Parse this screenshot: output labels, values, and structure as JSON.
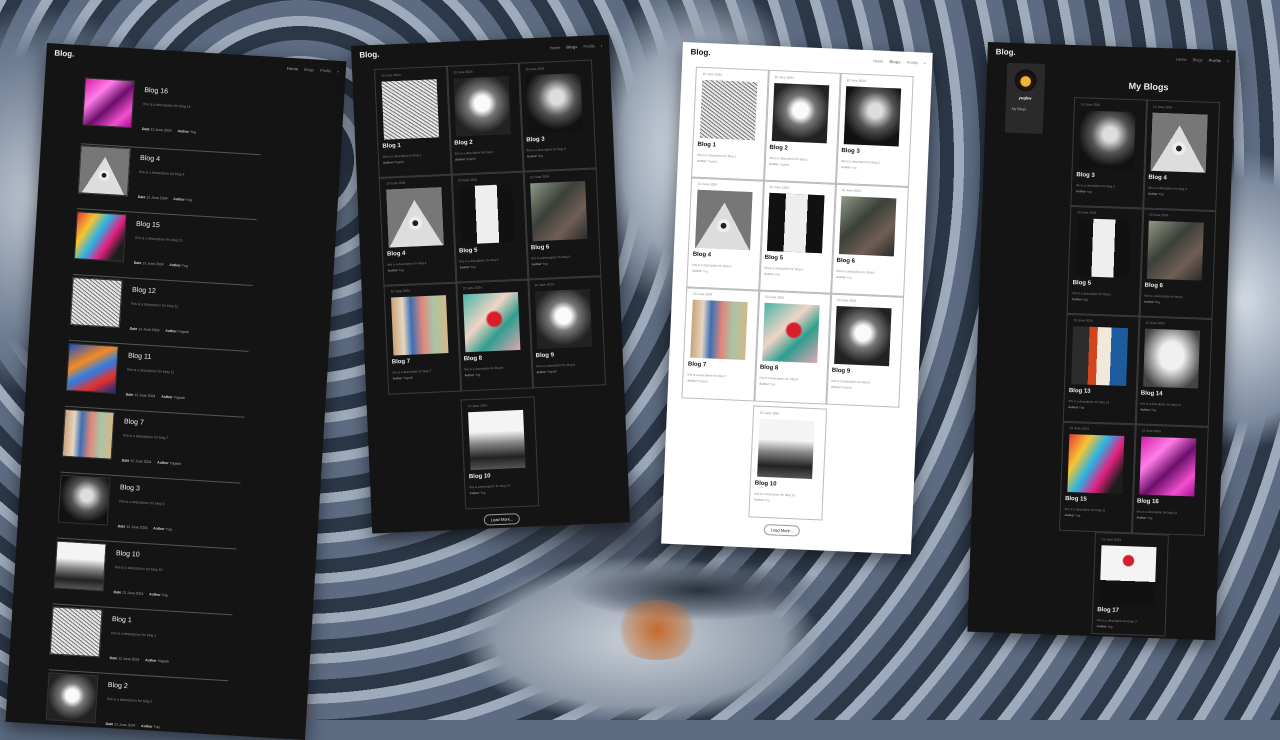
{
  "brand": "Blog.",
  "nav": {
    "home": "Home",
    "blogs": "Blogs",
    "profile": "Profile"
  },
  "load_more": "Load More...",
  "screen1": {
    "rows": [
      {
        "title": "Blog 16",
        "desc": "this is a description for blog 16",
        "date": "13 June 2024",
        "author": "Yug"
      },
      {
        "title": "Blog 4",
        "desc": "this is a description for blog 4",
        "date": "12 June 2024",
        "author": "Yug"
      },
      {
        "title": "Blog 15",
        "desc": "this is a description for blog 15",
        "date": "13 June 2024",
        "author": "Yug"
      },
      {
        "title": "Blog 12",
        "desc": "this is a description for blog 12",
        "date": "13 June 2024",
        "author": "Yogesh"
      },
      {
        "title": "Blog 11",
        "desc": "this is a description for blog 11",
        "date": "13 June 2024",
        "author": "Yogesh"
      },
      {
        "title": "Blog 7",
        "desc": "this is a description for blog 7",
        "date": "12 June 2024",
        "author": "Yogesh"
      },
      {
        "title": "Blog 3",
        "desc": "this is a description for blog 3",
        "date": "12 June 2024",
        "author": "Yug"
      },
      {
        "title": "Blog 10",
        "desc": "this is a description for blog 10",
        "date": "13 June 2024",
        "author": "Yug"
      },
      {
        "title": "Blog 1",
        "desc": "this is a description for blog 1",
        "date": "12 June 2024",
        "author": "Yogesh"
      },
      {
        "title": "Blog 2",
        "desc": "this is a description for blog 2",
        "date": "12 June 2024",
        "author": "Yug"
      }
    ]
  },
  "screen2": {
    "cards": [
      {
        "title": "Blog 1",
        "date": "10 June 2024",
        "desc": "this is a description for blog 1",
        "author": "Yogesh"
      },
      {
        "title": "Blog 2",
        "date": "10 June 2024",
        "desc": "this is a description for blog 2",
        "author": "Yogesh"
      },
      {
        "title": "Blog 3",
        "date": "10 June 2024",
        "desc": "this is a description for blog 3",
        "author": "Yug"
      },
      {
        "title": "Blog 4",
        "date": "10 June 2024",
        "desc": "this is a description for blog 4",
        "author": "Yug"
      },
      {
        "title": "Blog 5",
        "date": "10 June 2024",
        "desc": "this is a description for blog 5",
        "author": "Yug"
      },
      {
        "title": "Blog 6",
        "date": "10 June 2024",
        "desc": "this is a description for blog 6",
        "author": "Yug"
      },
      {
        "title": "Blog 7",
        "date": "10 June 2024",
        "desc": "this is a description for blog 7",
        "author": "Yogesh"
      },
      {
        "title": "Blog 8",
        "date": "10 June 2024",
        "desc": "this is a description for blog 8",
        "author": "Yug"
      },
      {
        "title": "Blog 9",
        "date": "10 June 2024",
        "desc": "this is a description for blog 9",
        "author": "Yogesh"
      },
      {
        "title": "Blog 10",
        "date": "10 June 2024",
        "desc": "this is a description for blog 10",
        "author": "Yug"
      }
    ]
  },
  "screen4": {
    "username": "yugbw",
    "sidebar_link": "My Blogs",
    "title": "My Blogs",
    "cards": [
      {
        "title": "Blog 3",
        "date": "10 June 2024",
        "desc": "this is a description for blog 3",
        "author": "Yug"
      },
      {
        "title": "Blog 4",
        "date": "10 June 2024",
        "desc": "this is a description for blog 4",
        "author": "Yug"
      },
      {
        "title": "Blog 5",
        "date": "10 June 2024",
        "desc": "this is a description for blog 5",
        "author": "Yug"
      },
      {
        "title": "Blog 6",
        "date": "10 June 2024",
        "desc": "this is a description for blog 6",
        "author": "Yug"
      },
      {
        "title": "Blog 13",
        "date": "13 June 2024",
        "desc": "this is a description for blog 13",
        "author": "Yug"
      },
      {
        "title": "Blog 14",
        "date": "13 June 2024",
        "desc": "this is a description for blog 14",
        "author": "Yug"
      },
      {
        "title": "Blog 15",
        "date": "13 June 2024",
        "desc": "this is a description for blog 15",
        "author": "Yug"
      },
      {
        "title": "Blog 16",
        "date": "13 June 2024",
        "desc": "this is a description for blog 16",
        "author": "Yug"
      },
      {
        "title": "Blog 17",
        "date": "13 June 2024",
        "desc": "this is a description for blog 17",
        "author": "Yug"
      }
    ]
  }
}
